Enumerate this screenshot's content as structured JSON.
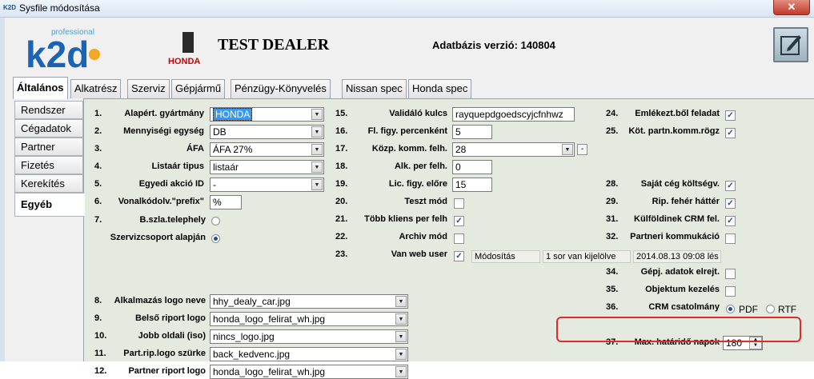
{
  "window": {
    "title": "Sysfile módosítása",
    "close": "✕",
    "app_icon": "K2D"
  },
  "header": {
    "dealer": "TEST DEALER",
    "db_version": "Adatbázis verzió: 140804",
    "logo_text": "k2d",
    "logo_small": "professional",
    "honda_text": "HONDA"
  },
  "tabs": [
    {
      "label": "Általános"
    },
    {
      "label": "Alkatrész"
    },
    {
      "label": "Szerviz"
    },
    {
      "label": "Gépjármű"
    },
    {
      "label": "Pénzügy-Könyvelés"
    },
    {
      "label": "Nissan spec"
    },
    {
      "label": "Honda spec"
    }
  ],
  "sidebar": [
    {
      "label": "Rendszer"
    },
    {
      "label": "Cégadatok"
    },
    {
      "label": "Partner"
    },
    {
      "label": "Fizetés"
    },
    {
      "label": "Kerekítés"
    },
    {
      "label": "Egyéb"
    }
  ],
  "fields": {
    "f1": {
      "num": "1.",
      "label": "Alapért. gyártmány",
      "value": "HONDA"
    },
    "f2": {
      "num": "2.",
      "label": "Mennyiségi egység",
      "value": "DB"
    },
    "f3": {
      "num": "3.",
      "label": "ÁFA",
      "value": "ÁFA 27%"
    },
    "f4": {
      "num": "4.",
      "label": "Listaár tipus",
      "value": "listaár"
    },
    "f5": {
      "num": "5.",
      "label": "Egyedi akció ID",
      "value": "-"
    },
    "f6": {
      "num": "6.",
      "label": "Vonalkódolv.\"prefix\"",
      "value": "%"
    },
    "f7": {
      "num": "7.",
      "label": "B.szla.telephely",
      "label2": "Szervizcsoport alapján"
    },
    "f8": {
      "num": "8.",
      "label": "Alkalmazás logo neve",
      "value": "hhy_dealy_car.jpg"
    },
    "f9": {
      "num": "9.",
      "label": "Belső riport logo",
      "value": "honda_logo_felirat_wh.jpg"
    },
    "f10": {
      "num": "10.",
      "label": "Jobb oldali (iso)",
      "value": "nincs_logo.jpg"
    },
    "f11": {
      "num": "11.",
      "label": "Part.rip.logo szürke",
      "value": "back_kedvenc.jpg"
    },
    "f12": {
      "num": "12.",
      "label": "Partner riport logo",
      "value": "honda_logo_felirat_wh.jpg"
    },
    "f15": {
      "num": "15.",
      "label": "Validáló kulcs",
      "value": "rayquepdgoedscyjcfnhwz"
    },
    "f16": {
      "num": "16.",
      "label": "Fl. figy. percenként",
      "value": "5"
    },
    "f17": {
      "num": "17.",
      "label": "Közp. komm. felh.",
      "value": "28",
      "btn": "-"
    },
    "f18": {
      "num": "18.",
      "label": "Alk. per felh.",
      "value": "0"
    },
    "f19": {
      "num": "19.",
      "label": "Lic. figy. előre",
      "value": "15"
    },
    "f20": {
      "num": "20.",
      "label": "Teszt mód"
    },
    "f21": {
      "num": "21.",
      "label": "Több kliens per felh"
    },
    "f22": {
      "num": "22.",
      "label": "Archiv mód"
    },
    "f23": {
      "num": "23.",
      "label": "Van web user",
      "col1": "Módosítás",
      "col2": "1 sor van kijelölve",
      "col3": "2014.08.13 09:08 lés"
    },
    "f24": {
      "num": "24.",
      "label": "Emlékezt.ből feladat"
    },
    "f25": {
      "num": "25.",
      "label": "Köt. partn.komm.rögz"
    },
    "f28": {
      "num": "28.",
      "label": "Saját cég költségv."
    },
    "f29": {
      "num": "29.",
      "label": "Rip. fehér háttér"
    },
    "f31": {
      "num": "31.",
      "label": "Külföldinek CRM fel."
    },
    "f32": {
      "num": "32.",
      "label": "Partneri kommukáció"
    },
    "f34": {
      "num": "34.",
      "label": "Gépj. adatok elrejt."
    },
    "f35": {
      "num": "35.",
      "label": "Objektum kezelés"
    },
    "f36": {
      "num": "36.",
      "label": "CRM csatolmány",
      "opt1": "PDF",
      "opt2": "RTF"
    },
    "f37": {
      "num": "37.",
      "label": "Max. határidő napok",
      "value": "180"
    }
  }
}
